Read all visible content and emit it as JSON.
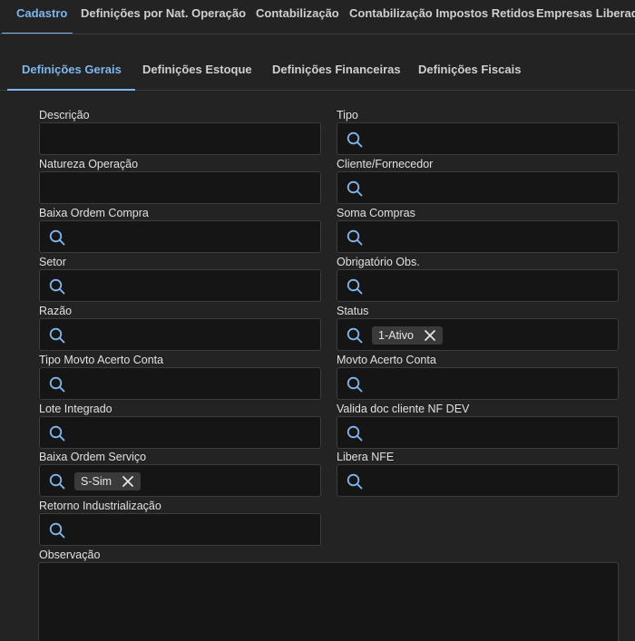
{
  "top_tabs": [
    {
      "label": "Cadastro",
      "active": true
    },
    {
      "label": "Definições por Nat. Operação",
      "active": false
    },
    {
      "label": "Contabilização",
      "active": false
    },
    {
      "label": "Contabilização Impostos Retidos",
      "active": false
    },
    {
      "label": "Empresas Liberadas",
      "active": false
    }
  ],
  "sub_tabs": [
    {
      "label": "Definições Gerais",
      "active": true
    },
    {
      "label": "Definições Estoque",
      "active": false
    },
    {
      "label": "Definições Financeiras",
      "active": false
    },
    {
      "label": "Definições Fiscais",
      "active": false
    }
  ],
  "form": {
    "descricao": {
      "label": "Descrição",
      "value": ""
    },
    "tipo": {
      "label": "Tipo",
      "value": ""
    },
    "natureza_operacao": {
      "label": "Natureza Operação",
      "value": ""
    },
    "cliente_fornecedor": {
      "label": "Cliente/Fornecedor",
      "value": ""
    },
    "baixa_ordem_compra": {
      "label": "Baixa Ordem Compra",
      "value": ""
    },
    "soma_compras": {
      "label": "Soma Compras",
      "value": ""
    },
    "setor": {
      "label": "Setor",
      "value": ""
    },
    "obrigatorio_obs": {
      "label": "Obrigatório Obs.",
      "value": ""
    },
    "razao": {
      "label": "Razão",
      "value": ""
    },
    "status": {
      "label": "Status",
      "chip": "1-Ativo"
    },
    "tipo_movto_acerto_conta": {
      "label": "Tipo Movto Acerto Conta",
      "value": ""
    },
    "movto_acerto_conta": {
      "label": "Movto Acerto Conta",
      "value": ""
    },
    "lote_integrado": {
      "label": "Lote Integrado",
      "value": ""
    },
    "valida_doc_cliente": {
      "label": "Valida doc cliente NF DEV",
      "value": ""
    },
    "baixa_ordem_servico": {
      "label": "Baixa Ordem Serviço",
      "chip": "S-Sim"
    },
    "libera_nfe": {
      "label": "Libera NFE",
      "value": ""
    },
    "retorno_industrializacao": {
      "label": "Retorno Industrialização",
      "value": ""
    },
    "observacao": {
      "label": "Observação",
      "value": ""
    }
  },
  "colors": {
    "background": "#232323",
    "field_background": "#151515",
    "accent": "#7fb6ec",
    "chip_background": "#3a3a3a"
  },
  "icons": {
    "lookup": "search-icon",
    "chip_remove": "close-icon"
  }
}
